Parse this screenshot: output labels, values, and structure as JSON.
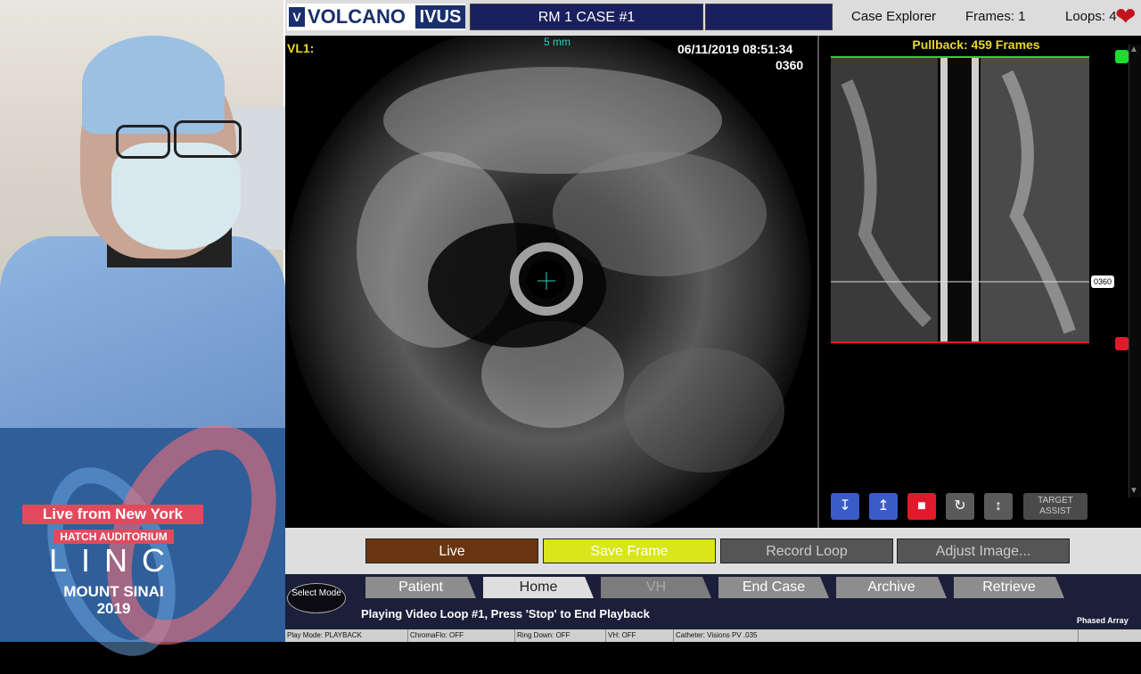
{
  "header": {
    "logo_v": "V",
    "logo_text": "VOLCANO",
    "logo_badge": "IVUS",
    "case_title": "RM 1 CASE #1",
    "case_explorer": "Case Explorer",
    "frames": "Frames: 1",
    "loops": "Loops: 4"
  },
  "ivus": {
    "view_label": "VL1:",
    "scale": "5 mm",
    "datetime": "06/11/2019 08:51:34",
    "frame_number": "0360"
  },
  "longitudinal": {
    "pullback": "Pullback: 459 Frames",
    "frame_tag": "0360",
    "target_assist": "TARGET ASSIST"
  },
  "buttons": {
    "live": "Live",
    "save_frame": "Save Frame",
    "record_loop": "Record Loop",
    "adjust_image": "Adjust Image..."
  },
  "tabs": {
    "select_mode": "Select Mode",
    "patient": "Patient",
    "home": "Home",
    "vh": "VH",
    "end_case": "End Case",
    "archive": "Archive",
    "retrieve": "Retrieve"
  },
  "status": {
    "message": "Playing Video Loop #1, Press 'Stop' to End Playback",
    "phased_array": "Phased Array"
  },
  "statusbar": {
    "play_mode": "Play Mode: PLAYBACK",
    "chromaflo": "ChromaFlo: OFF",
    "ring_down": "Ring Down: OFF",
    "vh": "VH: OFF",
    "catheter": "Catheter: Visions PV .035"
  },
  "branding": {
    "live_from": "Live from New York",
    "venue": "HATCH AUDITORIUM",
    "event": "LINC",
    "location": "MOUNT SINAI",
    "year": "2019"
  }
}
